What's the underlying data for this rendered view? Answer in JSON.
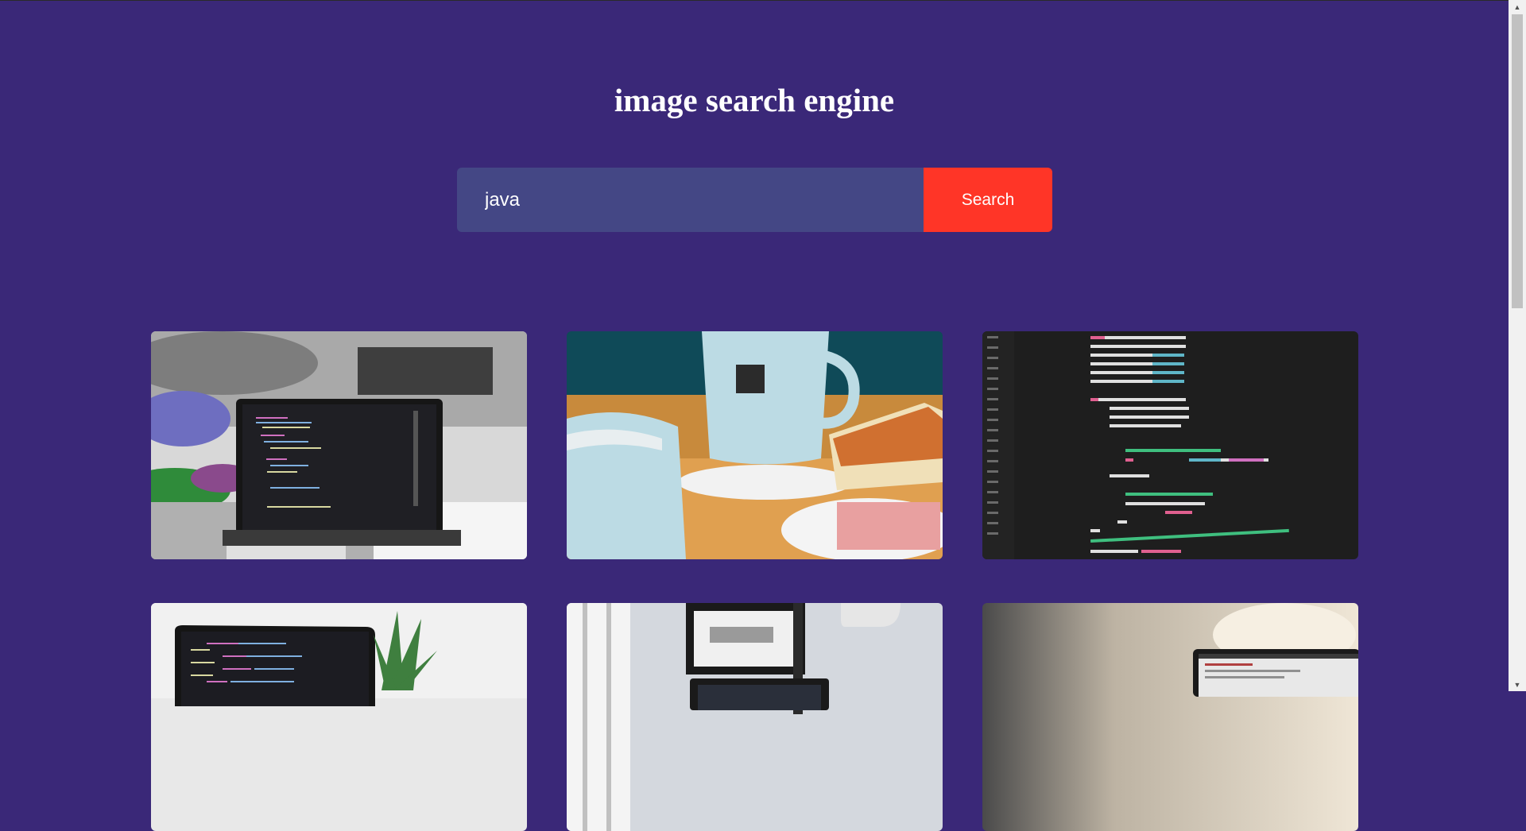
{
  "header": {
    "title": "image search engine"
  },
  "search": {
    "value": "java",
    "button_label": "Search"
  },
  "results": [
    {
      "alt": "laptop with code on desk"
    },
    {
      "alt": "java coffee cup and cake"
    },
    {
      "alt": "javascript code on dark editor"
    },
    {
      "alt": "laptop with code and plant"
    },
    {
      "alt": "desk with monitor and laptop"
    },
    {
      "alt": "laptop on wall background"
    }
  ],
  "colors": {
    "background": "#3a2878",
    "input_bg": "#444785",
    "button_bg": "#ff3527"
  }
}
